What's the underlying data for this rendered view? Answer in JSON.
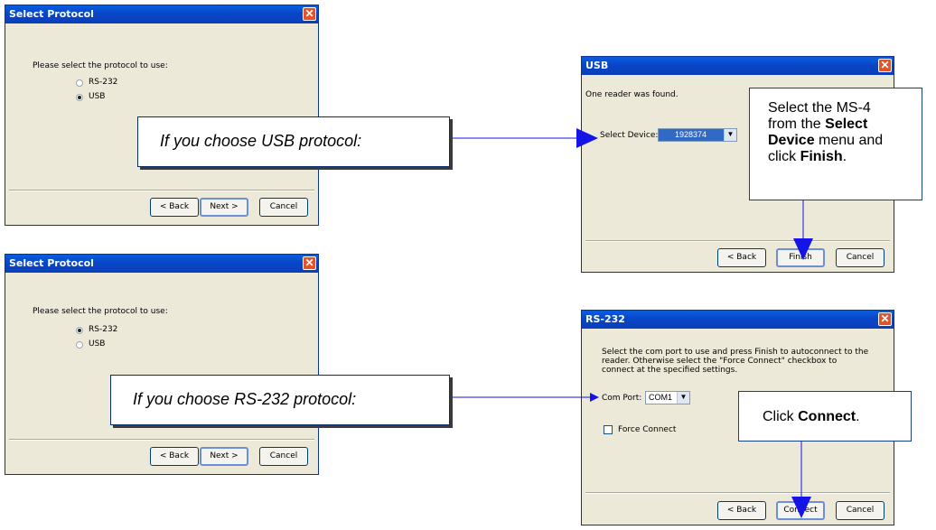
{
  "dialog1": {
    "title": "Select Protocol",
    "prompt": "Please select the protocol to use:",
    "options": [
      "RS-232",
      "USB"
    ],
    "selected": "USB",
    "buttons": {
      "back": "< Back",
      "next": "Next >",
      "cancel": "Cancel"
    }
  },
  "dialog2": {
    "title": "Select Protocol",
    "prompt": "Please select the protocol to use:",
    "options": [
      "RS-232",
      "USB"
    ],
    "selected": "RS-232",
    "buttons": {
      "back": "< Back",
      "next": "Next >",
      "cancel": "Cancel"
    }
  },
  "usb_dialog": {
    "title": "USB",
    "message": "One reader was found.",
    "select_label": "Select Device:",
    "device_value": "1928374",
    "buttons": {
      "back": "< Back",
      "finish": "Finish",
      "cancel": "Cancel"
    }
  },
  "rs232_dialog": {
    "title": "RS-232",
    "message_lines": [
      "Select the com port to use and press Finish to autoconnect to the",
      "reader. Otherwise select the \"Force Connect\" checkbox to",
      "connect at the specified settings."
    ],
    "port_label": "Com Port:",
    "port_value": "COM1",
    "force_connect_label": "Force Connect",
    "buttons": {
      "back": "< Back",
      "connect": "Connect",
      "cancel": "Cancel"
    }
  },
  "callouts": {
    "usb": "If you choose USB protocol:",
    "rs232": "If you choose RS-232 protocol:"
  },
  "notes": {
    "usb": {
      "line1": "Select the MS-4",
      "line2_pre": "from the ",
      "line2_bold": "Select",
      "line3_bold": "Device",
      "line3_post": " menu and",
      "line4_pre": "click ",
      "line4_bold": "Finish",
      "line4_post": "."
    },
    "rs232": {
      "pre": "Click ",
      "bold": "Connect",
      "post": "."
    }
  },
  "colors": {
    "titlebar": "#0a46c8",
    "dialog_bg": "#ece9d8",
    "arrow": "#1414e6"
  }
}
